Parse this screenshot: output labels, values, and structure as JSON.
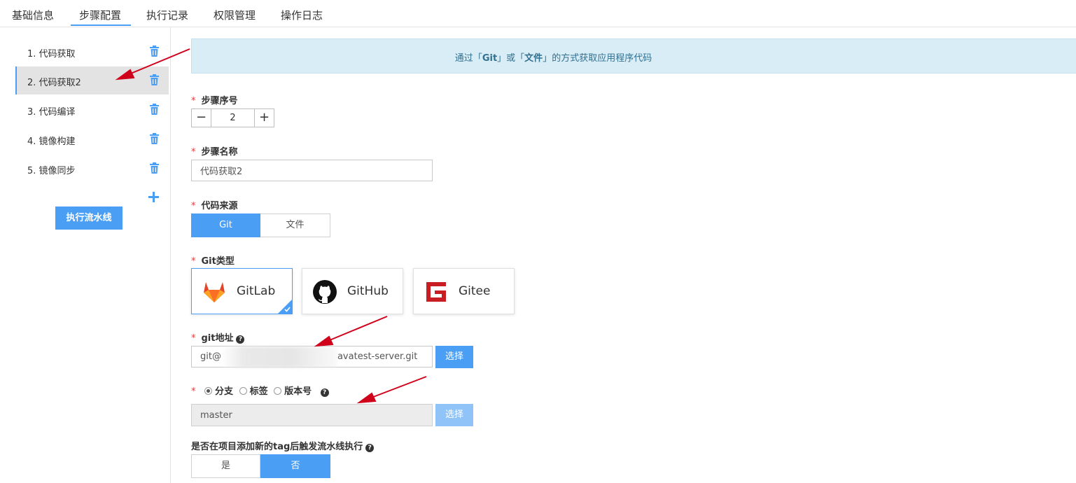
{
  "tabs": [
    {
      "label": "基础信息"
    },
    {
      "label": "步骤配置"
    },
    {
      "label": "执行记录"
    },
    {
      "label": "权限管理"
    },
    {
      "label": "操作日志"
    }
  ],
  "active_tab": "步骤配置",
  "steps": [
    {
      "label": "1. 代码获取"
    },
    {
      "label": "2. 代码获取2",
      "active": true
    },
    {
      "label": "3. 代码编译"
    },
    {
      "label": "4. 镜像构建"
    },
    {
      "label": "5. 镜像同步"
    }
  ],
  "run_pipeline_label": "执行流水线",
  "banner": {
    "prefix": "通过「",
    "git": "Git",
    "middle": "」或「",
    "file": "文件",
    "suffix": "」的方式获取应用程序代码"
  },
  "form": {
    "required_mark": "*",
    "step_number": {
      "label": "步骤序号",
      "value": "2",
      "minus": "−",
      "plus": "+"
    },
    "step_name": {
      "label": "步骤名称",
      "value": "代码获取2"
    },
    "code_source": {
      "label": "代码来源",
      "options": [
        "Git",
        "文件"
      ],
      "selected": "Git"
    },
    "git_type": {
      "label": "Git类型",
      "options": [
        {
          "name": "GitLab",
          "icon": "gitlab-icon",
          "selected": true
        },
        {
          "name": "GitHub",
          "icon": "github-icon"
        },
        {
          "name": "Gitee",
          "icon": "gitee-icon"
        }
      ]
    },
    "git_address": {
      "label": "git地址",
      "value_prefix": "git@",
      "value_suffix": "avatest-server.git",
      "select_label": "选择"
    },
    "ref_type": {
      "options": [
        "分支",
        "标签",
        "版本号"
      ],
      "selected": "分支",
      "value": "master",
      "select_label": "选择"
    },
    "tag_trigger": {
      "label": "是否在项目添加新的tag后触发流水线执行",
      "options": [
        "是",
        "否"
      ],
      "selected": "否"
    }
  },
  "colors": {
    "accent": "#4a9ff5",
    "required": "#e23c3c",
    "banner_bg": "#d9edf7",
    "banner_text": "#31708f",
    "annotation_arrow": "#d0021b"
  }
}
